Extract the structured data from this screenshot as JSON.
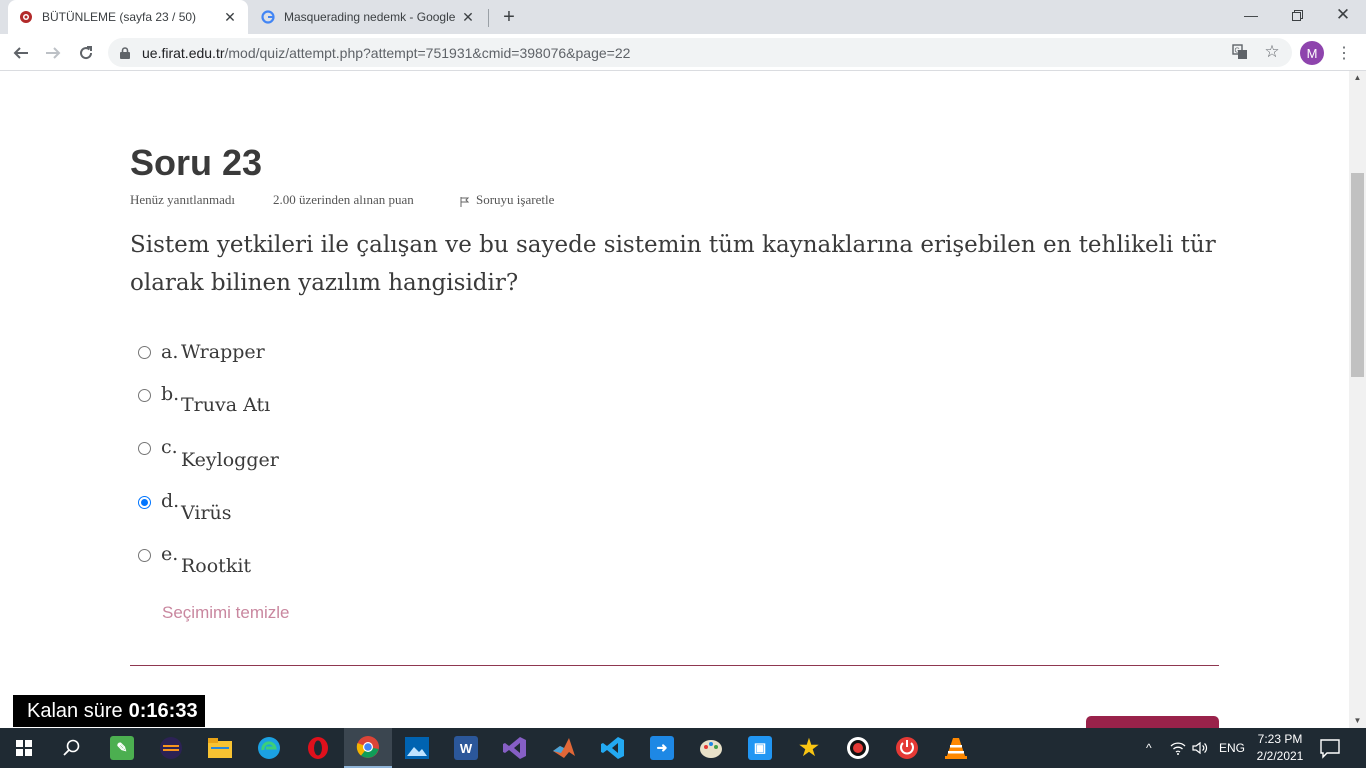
{
  "browser": {
    "tabs": [
      {
        "title": "BÜTÜNLEME (sayfa 23 / 50)",
        "active": true
      },
      {
        "title": "Masquerading nedemk - Google",
        "active": false
      }
    ],
    "url_host": "ue.firat.edu.tr",
    "url_path": "/mod/quiz/attempt.php?attempt=751931&cmid=398076&page=22",
    "profile_initial": "M"
  },
  "question": {
    "title": "Soru 23",
    "status": "Henüz yanıtlanmadı",
    "points": "2.00 üzerinden alınan puan",
    "flag_label": "Soruyu işaretle",
    "text": "Sistem yetkileri ile çalışan ve bu sayede sistemin tüm kaynaklarına erişebilen en tehlikeli tür olarak bilinen yazılım hangisidir?",
    "options": [
      {
        "letter": "a.",
        "text": "Wrapper",
        "selected": false
      },
      {
        "letter": "b.",
        "text": "Truva Atı",
        "selected": false
      },
      {
        "letter": "c.",
        "text": "Keylogger",
        "selected": false
      },
      {
        "letter": "d.",
        "text": "Virüs",
        "selected": true
      },
      {
        "letter": "e.",
        "text": "Rootkit",
        "selected": false
      }
    ],
    "clear_label": "Seçimimi temizle"
  },
  "timer": {
    "label": "Kalan süre",
    "value": "0:16:33"
  },
  "taskbar": {
    "language": "ENG",
    "time": "7:23 PM",
    "date": "2/2/2021"
  },
  "colors": {
    "accent": "#99224a",
    "clear_link": "#c9879f",
    "radio_checked": "#0075ff"
  }
}
